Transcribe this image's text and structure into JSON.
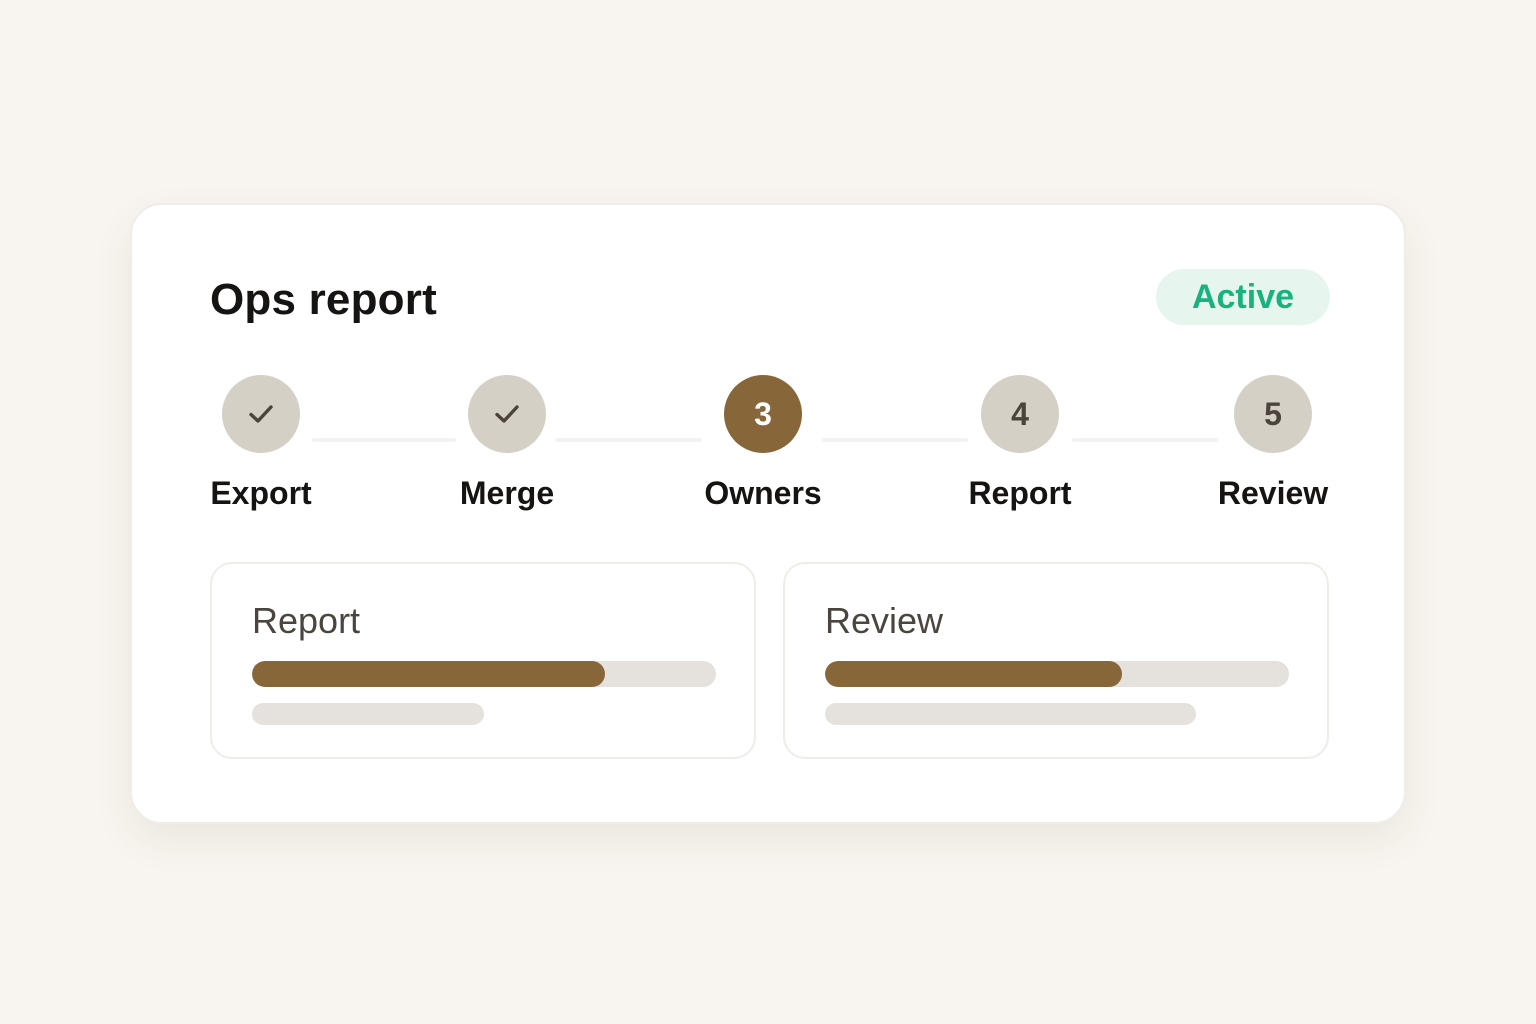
{
  "card": {
    "title": "Ops report",
    "status": "Active",
    "status_color": "#18b27e",
    "accent_color": "#87663a"
  },
  "stepper": {
    "current_step": 3,
    "steps": [
      {
        "number": "1",
        "label": "Export",
        "state": "complete",
        "icon": "check-icon"
      },
      {
        "number": "2",
        "label": "Merge",
        "state": "complete",
        "icon": "check-icon"
      },
      {
        "number": "3",
        "label": "Owners",
        "state": "current"
      },
      {
        "number": "4",
        "label": "Report",
        "state": "upcoming"
      },
      {
        "number": "5",
        "label": "Review",
        "state": "upcoming"
      }
    ]
  },
  "panels": [
    {
      "title": "Report",
      "progress": 0.76,
      "detail_fill": 0.5
    },
    {
      "title": "Review",
      "progress": 0.64,
      "detail_fill": 0.8
    }
  ]
}
